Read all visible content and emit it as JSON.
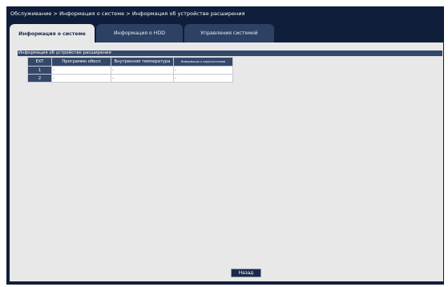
{
  "breadcrumb": "Обслуживание > Информация о системе > Информация об устройстве расширения",
  "tabs": [
    {
      "label": "Информация о системе"
    },
    {
      "label": "Информация о HDD"
    },
    {
      "label": "Управления системой"
    }
  ],
  "section": {
    "title": "Информация об устройстве расширения"
  },
  "table": {
    "headers": [
      "EXT",
      "Программн обесп",
      "Внутренняя температура",
      "Информация о ходе/состоянии"
    ],
    "rows": [
      {
        "ext": "1",
        "cells": [
          "-",
          "-",
          "-"
        ]
      },
      {
        "ext": "2",
        "cells": [
          "-",
          "-",
          "-"
        ]
      }
    ]
  },
  "footer": {
    "back_label": "Назад"
  },
  "colors": {
    "frame": "#0f1e3a",
    "header": "#34486c",
    "panel": "#e8e8e8"
  }
}
